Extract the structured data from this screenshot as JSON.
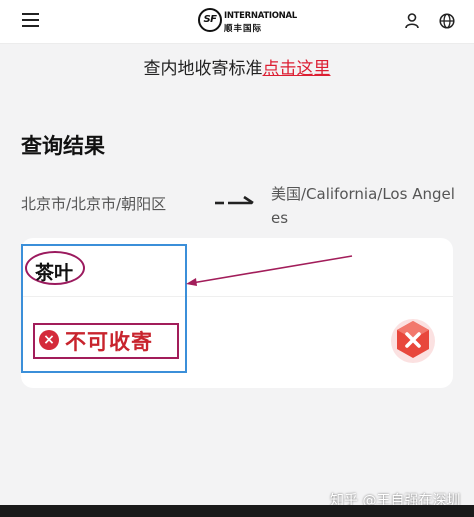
{
  "header": {
    "logo_mark": "SF",
    "logo_en": "INTERNATIONAL",
    "logo_cn": "顺丰国际"
  },
  "notice": {
    "text": "查内地收寄标准",
    "link": "点击这里"
  },
  "result": {
    "title": "查询结果",
    "from": "北京市/北京市/朝阳区",
    "to": "美国/California/Los Angeles",
    "item_name": "茶叶",
    "status": "不可收寄"
  },
  "watermark": "知乎 @王自强在深圳",
  "colors": {
    "accent_red": "#dc1e32",
    "annotation_blue": "#3b8fd9",
    "annotation_magenta": "#a21d5a"
  }
}
